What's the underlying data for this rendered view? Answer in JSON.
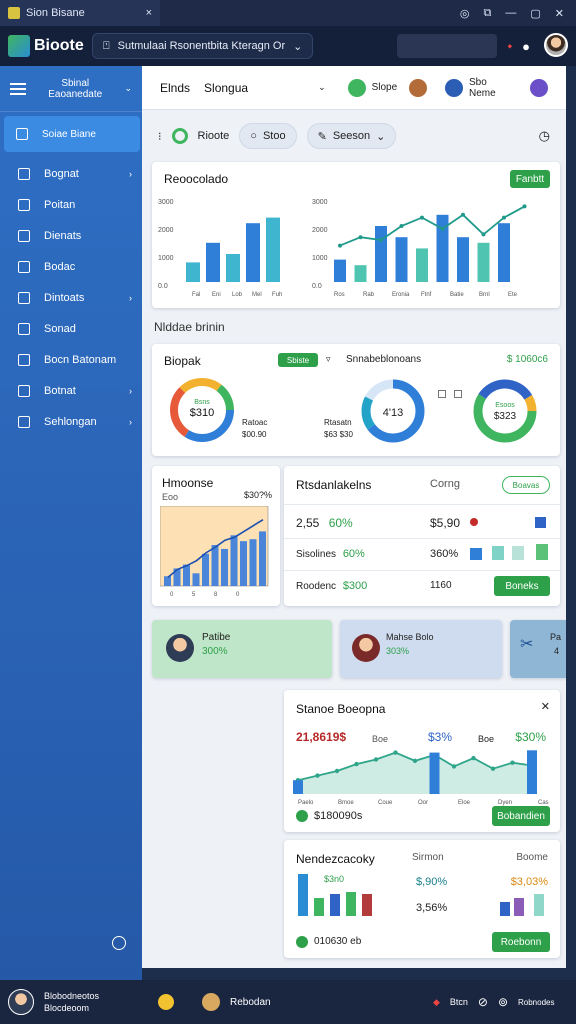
{
  "window": {
    "tab_title": "Sion Bisane",
    "close": "×"
  },
  "app": {
    "logo": "Bioote",
    "menu": "Sutmulaai Rsonentbita Kteragn Or"
  },
  "sidebar": {
    "header": "Sbinal Eaoanedate",
    "items": [
      {
        "label": "Soiae Biane",
        "active": true,
        "chev": false
      },
      {
        "label": "Bognat",
        "chev": true
      },
      {
        "label": "Poitan",
        "chev": false
      },
      {
        "label": "Dienats",
        "chev": false
      },
      {
        "label": "Bodac",
        "chev": false
      },
      {
        "label": "Dintoats",
        "chev": true
      },
      {
        "label": "Sonad",
        "chev": false
      },
      {
        "label": "Bocn Batonam",
        "chev": false
      },
      {
        "label": "Botnat",
        "chev": true
      },
      {
        "label": "Sehlongan",
        "chev": true
      }
    ]
  },
  "main": {
    "title_a": "Elnds",
    "title_b": "Slongua",
    "status_a": "Slope",
    "status_b": "Sbo Neme",
    "tools": {
      "stat": "Rioote",
      "stop": "Stoo",
      "season": "Seeson"
    }
  },
  "card1": {
    "title": "Reoocolado",
    "button": "Fanbtt",
    "left": {
      "ticks": [
        "3000",
        "2000",
        "1000",
        "0.0"
      ],
      "x": [
        "Fal",
        "Eni",
        "Lob",
        "Mel",
        "Fuh"
      ],
      "values": [
        700,
        1400,
        1000,
        2100,
        2300
      ]
    },
    "right": {
      "ticks": [
        "3000",
        "2000",
        "1000",
        "0.0"
      ],
      "x": [
        "Ros",
        "Rab",
        "Eronia",
        "Ftnf",
        "Batie",
        "Brnl",
        "Ete"
      ],
      "values": [
        800,
        600,
        2000,
        1600,
        1200,
        2400,
        1600,
        1400,
        2100,
        0
      ],
      "line": [
        1300,
        1600,
        1500,
        2000,
        2300,
        1900,
        2400,
        1700,
        2300,
        2700
      ]
    }
  },
  "section_label": "Nlddae brinin",
  "card2": {
    "title": "Biopak",
    "badge": "Sbiste",
    "sort": "▿",
    "subtitle": "Snnabeblonoans",
    "stat": "$ 1060c6",
    "donut1": {
      "center": "$310",
      "label_a": "Bsns",
      "legend_a": "Ratoac",
      "legend_b": "$00.90"
    },
    "donut2": {
      "center": "4'13",
      "legend_a": "Rtasatn",
      "legend_b": "$63 $30"
    },
    "donut3": {
      "center": "$323",
      "label_a": "Esoos"
    }
  },
  "card3": {
    "title": "Hmoonse",
    "title_b": "Eoo",
    "stat": "$30?%",
    "values": [
      100,
      180,
      220,
      130,
      330,
      420,
      380,
      520,
      460,
      480,
      560
    ],
    "line": [
      90,
      170,
      210,
      260,
      340,
      400,
      470,
      500,
      560,
      620,
      680
    ]
  },
  "card4": {
    "title": "Rtsdanlakelns",
    "col": "Corng",
    "button": "Boavas",
    "rows": [
      {
        "a": "2,55",
        "b": "60%",
        "c": "$5,90",
        "d": ""
      },
      {
        "a": "Sisolines",
        "b": "60%",
        "c": "360%",
        "d": ""
      },
      {
        "a": "Roodenc",
        "b": "$300",
        "c": "1160",
        "d": "Boneks"
      }
    ]
  },
  "promo": [
    {
      "title": "Patibe",
      "value": "300%"
    },
    {
      "title": "Mahse Bolo",
      "value": "303%"
    },
    {
      "title": "Pa",
      "value": "4"
    }
  ],
  "card5": {
    "title": "Stanoe Boeopna",
    "value_a": "21,8619$",
    "value_a_label": "Boe",
    "value_b": "$3%",
    "value_c": "$30%",
    "x": [
      "Paelo",
      "Bmoe",
      "Coue",
      "Oor",
      "Eloe",
      "Dyen",
      "Cas"
    ],
    "bars": [
      30,
      0,
      0,
      0,
      0,
      0,
      0,
      90,
      0,
      0,
      0,
      0,
      95
    ],
    "line": [
      30,
      40,
      50,
      65,
      75,
      90,
      72,
      85,
      60,
      78,
      55,
      68,
      62
    ],
    "footer": "$180090s",
    "button": "Bobandien"
  },
  "card6": {
    "title": "Nendezcacoky",
    "col_b": "Sirmon",
    "col_c": "Boome",
    "inner": "$3n0",
    "stat_a": "$,90%",
    "stat_b": "3,56%",
    "stat_c": "$3,03%",
    "footer": "010630 eb",
    "button": "Roebonn"
  },
  "taskbar": {
    "user_a": "Blobodneotos",
    "user_b": "Blocdeoom",
    "label": "Rebodan",
    "right_a": "Btcn",
    "right_b": "Robnodes"
  },
  "colors": {
    "sidebar": "#2e6fc4",
    "green": "#2ea04a",
    "blue": "#2f7ed8",
    "teal": "#4ab3a8"
  }
}
